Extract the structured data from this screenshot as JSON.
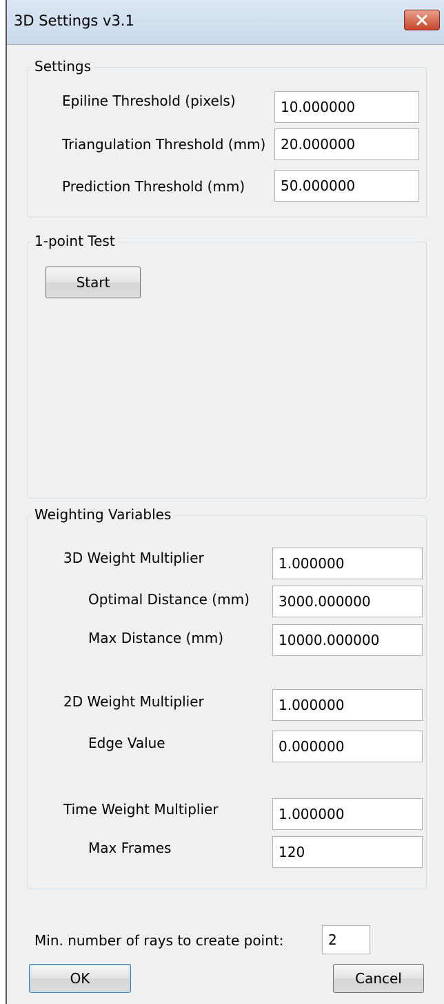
{
  "window": {
    "title": "3D Settings v3.1"
  },
  "settings": {
    "group_label": "Settings",
    "rows": [
      {
        "label": "Epiline Threshold (pixels)",
        "value": "10.000000"
      },
      {
        "label": "Triangulation Threshold (mm)",
        "value": "20.000000"
      },
      {
        "label": "Prediction Threshold (mm)",
        "value": "50.000000"
      }
    ]
  },
  "test": {
    "group_label": "1-point Test",
    "start_label": "Start"
  },
  "weighting": {
    "group_label": "Weighting Variables",
    "rows": [
      {
        "label": "3D Weight Multiplier",
        "value": "1.000000"
      },
      {
        "label": "Optimal Distance (mm)",
        "value": "3000.000000"
      },
      {
        "label": "Max Distance (mm)",
        "value": "10000.000000"
      },
      {
        "label": "2D Weight Multiplier",
        "value": "1.000000"
      },
      {
        "label": "Edge Value",
        "value": "0.000000"
      },
      {
        "label": "Time Weight Multiplier",
        "value": "1.000000"
      },
      {
        "label": "Max Frames",
        "value": "120"
      }
    ]
  },
  "min_rays": {
    "label": "Min. number of rays to create point:",
    "value": "2"
  },
  "footer": {
    "ok_label": "OK",
    "cancel_label": "Cancel"
  }
}
